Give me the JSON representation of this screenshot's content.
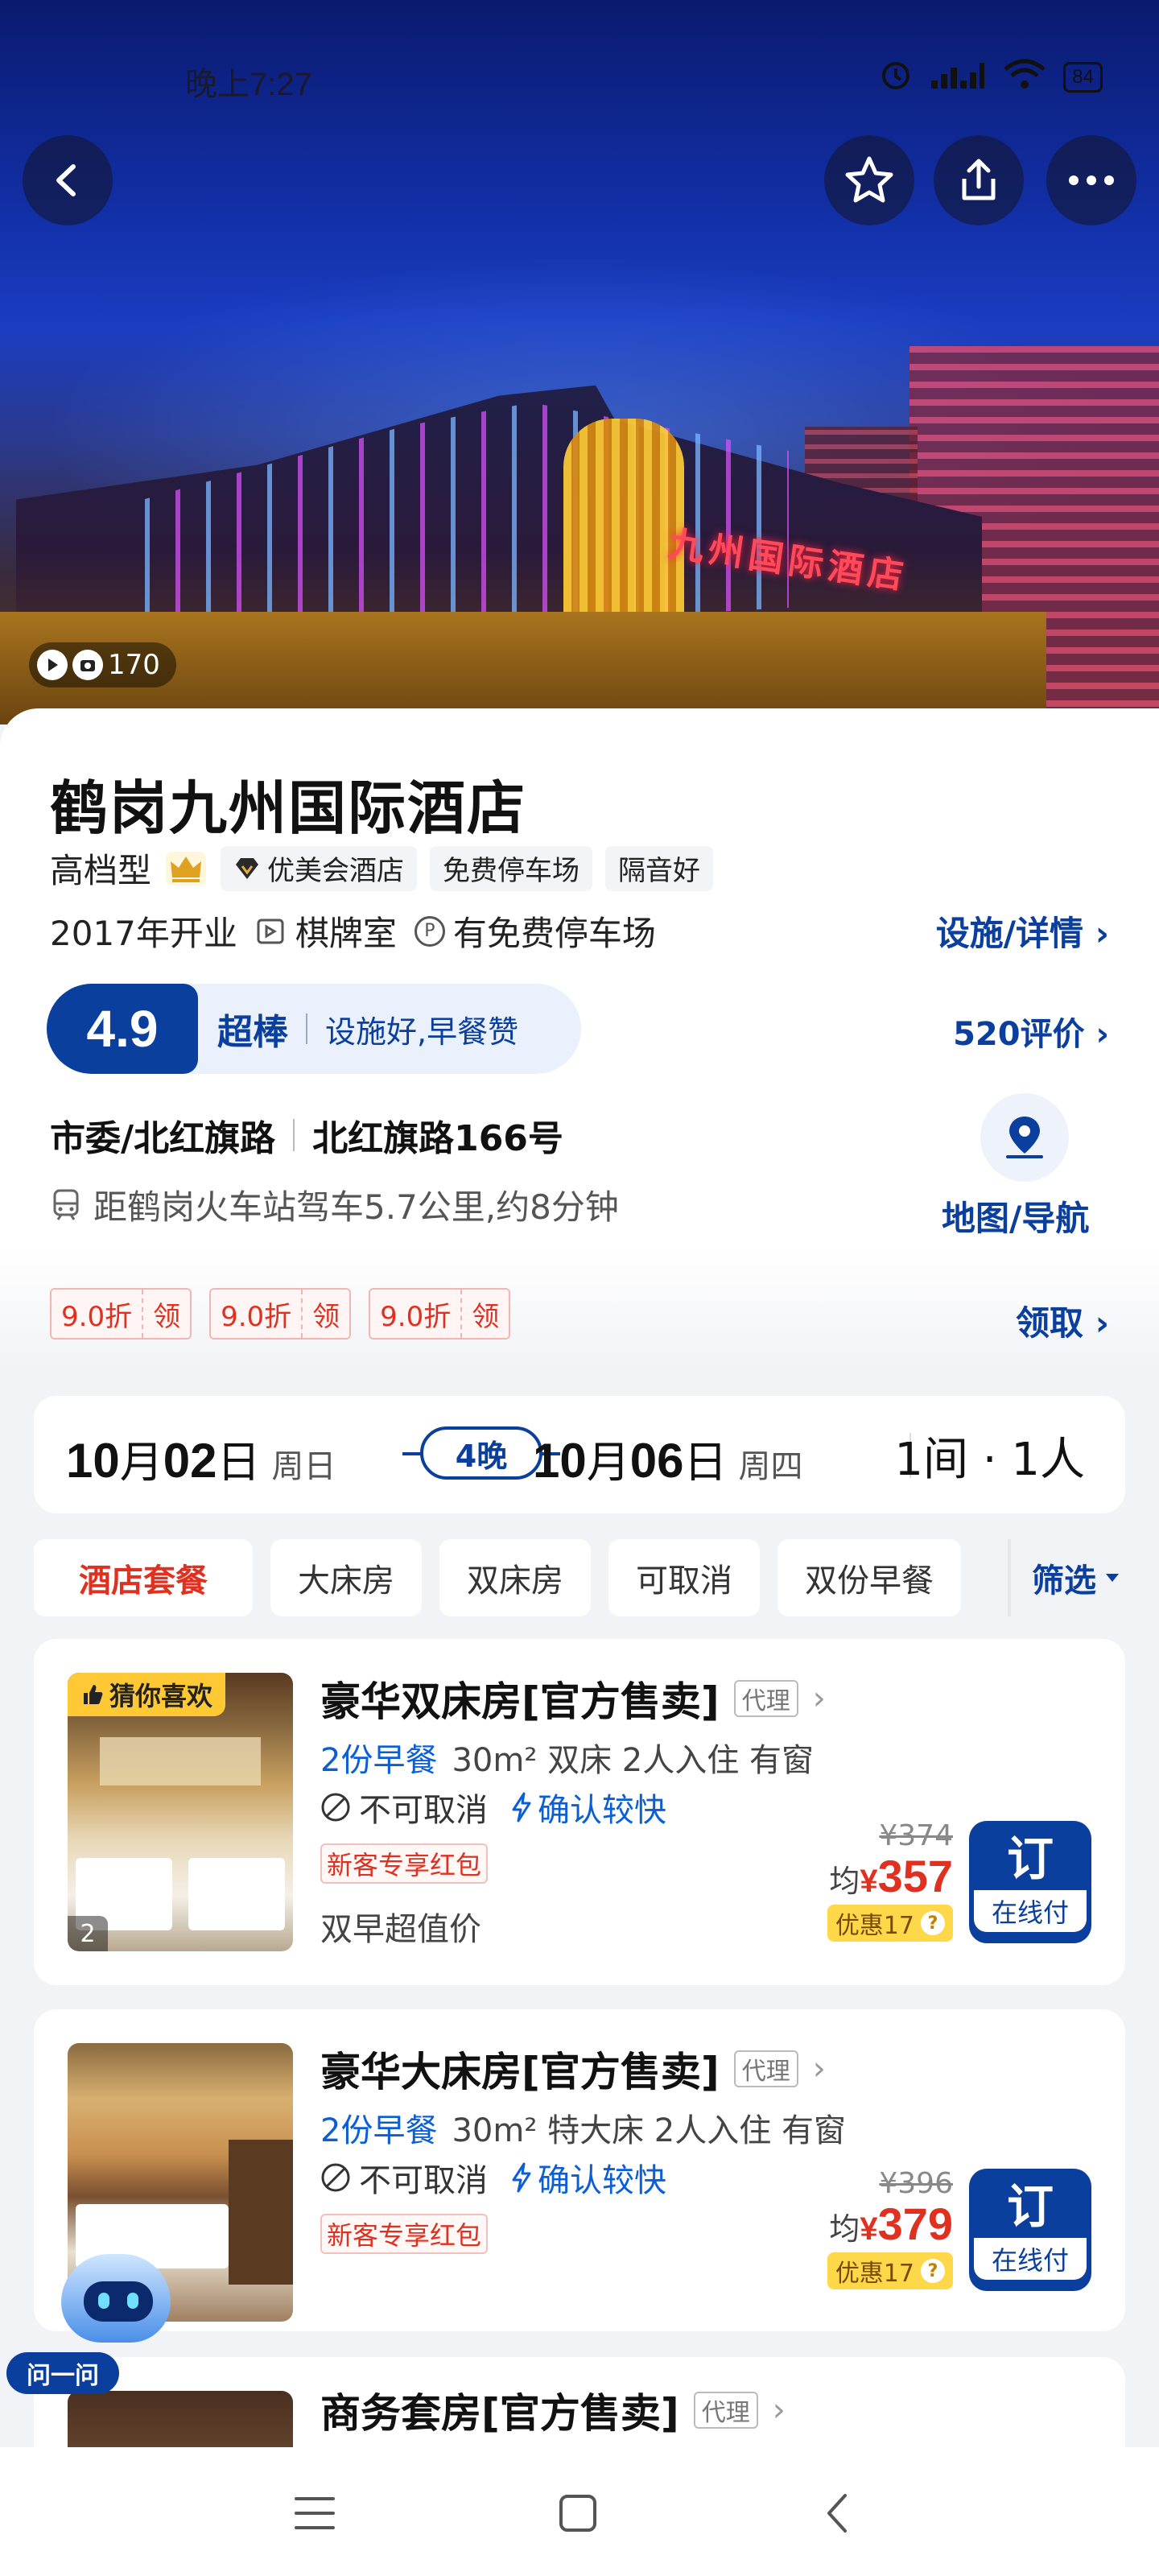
{
  "status": {
    "time": "晚上7:27",
    "battery": "84"
  },
  "hero": {
    "photo_count": "170",
    "sign_text": "九州国际酒店"
  },
  "hotel": {
    "name": "鹤岗九州国际酒店",
    "tier": "高档型",
    "badges": [
      "优美会酒店",
      "免费停车场",
      "隔音好"
    ],
    "opened": "2017年开业",
    "amenity1": "棋牌室",
    "amenity2": "有免费停车场",
    "detail_link": "设施/详情",
    "score": "4.9",
    "score_word": "超棒",
    "score_desc": "设施好,早餐赞",
    "reviews": "520评价",
    "area": "市委/北红旗路",
    "address": "北红旗路166号",
    "distance": "距鹤岗火车站驾车5.7公里,约8分钟",
    "map_label": "地图/导航"
  },
  "coupons": [
    {
      "value": "9.0折",
      "action": "领"
    },
    {
      "value": "9.0折",
      "action": "领"
    },
    {
      "value": "9.0折",
      "action": "领"
    }
  ],
  "claim_link": "领取",
  "dates": {
    "checkin_md": "10",
    "checkin_m": "月",
    "checkin_d": "02",
    "checkin_dcn": "日",
    "checkin_wk": "周日",
    "nights": "4晚",
    "checkout_md": "10",
    "checkout_m": "月",
    "checkout_d": "06",
    "checkout_dcn": "日",
    "checkout_wk": "周四",
    "rooms": "1间 · 1人"
  },
  "filters": [
    "酒店套餐",
    "大床房",
    "双床房",
    "可取消",
    "双份早餐"
  ],
  "filter_btn": "筛选",
  "rooms": [
    {
      "badge": "猜你喜欢",
      "img_count": "2",
      "title": "豪华双床房[官方售卖]",
      "agent": "代理",
      "breakfast": "2份早餐",
      "specs": "30m² 双床 2人入住 有窗",
      "cancel": "不可取消",
      "confirm": "确认较快",
      "promo": "新客专享红包",
      "note": "双早超值价",
      "price_old": "¥374",
      "price_avg": "均",
      "price_cur": "¥",
      "price_new": "357",
      "discount": "优惠17",
      "book": "订",
      "pay": "在线付"
    },
    {
      "title": "豪华大床房[官方售卖]",
      "agent": "代理",
      "breakfast": "2份早餐",
      "specs": "30m² 特大床 2人入住 有窗",
      "cancel": "不可取消",
      "confirm": "确认较快",
      "promo": "新客专享红包",
      "price_old": "¥396",
      "price_avg": "均",
      "price_cur": "¥",
      "price_new": "379",
      "discount": "优惠17",
      "book": "订",
      "pay": "在线付"
    },
    {
      "title": "商务套房[官方售卖]",
      "agent": "代理"
    }
  ],
  "assistant": {
    "label": "问一问"
  },
  "colors": {
    "primary": "#0b3f9e",
    "accent_red": "#e03020",
    "discount_yellow": "#ffd84a"
  }
}
